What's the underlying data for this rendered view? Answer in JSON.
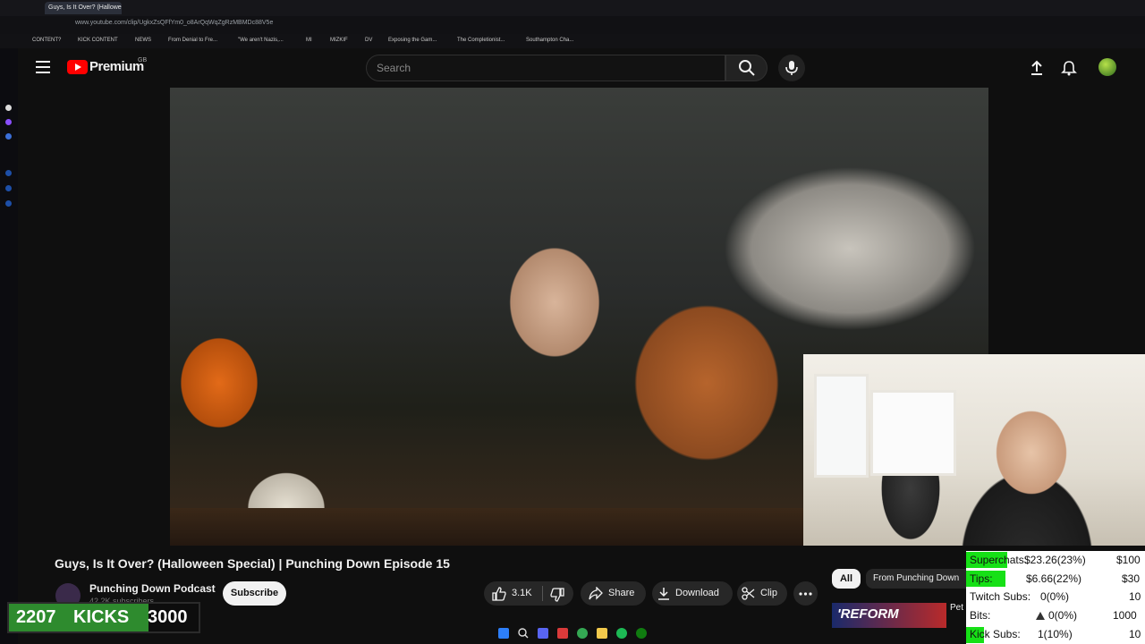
{
  "browser": {
    "tab_title": "Guys, Is It Over? (Hallowe",
    "url": "www.youtube.com/clip/UgkxZsQFfYm0_o8ArQqWqZgRzMBMDc88V5e",
    "bookmarks": [
      "CONTENT?",
      "KICK CONTENT",
      "NEWS",
      "From Denial to Fre...",
      "\"We aren't Nazis,...",
      "MI",
      "MIZKIF",
      "DV",
      "Exposing the Gam...",
      "The Completionist...",
      "Southampton Cha..."
    ]
  },
  "header": {
    "logo_text": "Premium",
    "logo_region": "GB",
    "search_placeholder": "Search"
  },
  "video": {
    "title": "Guys, Is It Over? (Halloween Special) | Punching Down Episode 15",
    "channel_name": "Punching Down Podcast",
    "subscriber_count": "42.2K subscribers",
    "subscribe_label": "Subscribe",
    "like_count": "3.1K",
    "share_label": "Share",
    "download_label": "Download",
    "clip_label": "Clip"
  },
  "chips": {
    "all": "All",
    "from_channel": "From Punching Down"
  },
  "recommendation": {
    "thumb_text": "'REFORM",
    "title_partial": "Pet"
  },
  "kicks": {
    "current": "2207",
    "label": "KICKS",
    "goal": "3000",
    "progress": 0.736
  },
  "stats": [
    {
      "label": "Superchats:",
      "value": "$23.26(23%)",
      "goal": "$100",
      "fill": 0.23
    },
    {
      "label": "Tips:",
      "value": "$6.66(22%)",
      "goal": "$30",
      "fill": 0.22
    },
    {
      "label": "Twitch Subs:",
      "value": "0(0%)",
      "goal": "10",
      "fill": 0
    },
    {
      "label": "Bits:",
      "value": "0(0%)",
      "goal": "1000",
      "fill": 0
    },
    {
      "label": "Kick Subs:",
      "value": "1(10%)",
      "goal": "10",
      "fill": 0.1
    }
  ]
}
